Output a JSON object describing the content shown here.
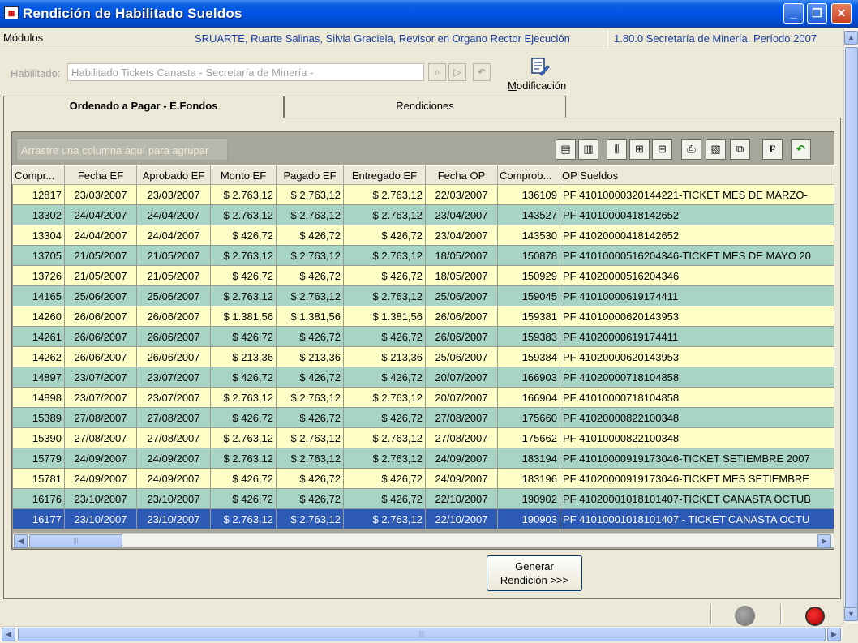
{
  "window": {
    "title": "Rendición de Habilitado Sueldos",
    "icon_name": "app-icon",
    "minimize_icon": "minimize-icon",
    "restore_icon": "restore-icon",
    "close_icon": "close-icon"
  },
  "menubar": {
    "modulos": "Módulos",
    "user_info": "SRUARTE, Ruarte Salinas, Silvia Graciela, Revisor en Organo Rector Ejecución",
    "version_info": "1.80.0 Secretaría de Minería, Período 2007"
  },
  "habilitado": {
    "label": "Habilitado:",
    "value": "Habilitado  Tickets Canasta - Secretaría de Minería -"
  },
  "toolbar": {
    "modificacion_label": "Modificación"
  },
  "tabs": [
    {
      "label": "Ordenado a Pagar - E.Fondos",
      "active": true
    },
    {
      "label": "Rendiciones",
      "active": false
    }
  ],
  "grid": {
    "group_by_placeholder": "Arrastre una columna aquí para agrupar",
    "columns": [
      "Compr...",
      "Fecha EF",
      "Aprobado EF",
      "Monto EF",
      "Pagado EF",
      "Entregado EF",
      "Fecha OP",
      "Comprob...",
      "OP Sueldos"
    ],
    "rows": [
      {
        "comp": "12817",
        "fecha_ef": "23/03/2007",
        "aprobado_ef": "23/03/2007",
        "monto": "$ 2.763,12",
        "pagado": "$ 2.763,12",
        "entregado": "$ 2.763,12",
        "fecha_op": "22/03/2007",
        "comprob": "136109",
        "op": "PF 41010000320144221-TICKET MES DE MARZO-",
        "color": "yellow"
      },
      {
        "comp": "13302",
        "fecha_ef": "24/04/2007",
        "aprobado_ef": "24/04/2007",
        "monto": "$ 2.763,12",
        "pagado": "$ 2.763,12",
        "entregado": "$ 2.763,12",
        "fecha_op": "23/04/2007",
        "comprob": "143527",
        "op": "PF 41010000418142652",
        "color": "green"
      },
      {
        "comp": "13304",
        "fecha_ef": "24/04/2007",
        "aprobado_ef": "24/04/2007",
        "monto": "$ 426,72",
        "pagado": "$ 426,72",
        "entregado": "$ 426,72",
        "fecha_op": "23/04/2007",
        "comprob": "143530",
        "op": "PF 41020000418142652",
        "color": "yellow"
      },
      {
        "comp": "13705",
        "fecha_ef": "21/05/2007",
        "aprobado_ef": "21/05/2007",
        "monto": "$ 2.763,12",
        "pagado": "$ 2.763,12",
        "entregado": "$ 2.763,12",
        "fecha_op": "18/05/2007",
        "comprob": "150878",
        "op": "PF 41010000516204346-TICKET MES DE MAYO 20",
        "color": "green"
      },
      {
        "comp": "13726",
        "fecha_ef": "21/05/2007",
        "aprobado_ef": "21/05/2007",
        "monto": "$ 426,72",
        "pagado": "$ 426,72",
        "entregado": "$ 426,72",
        "fecha_op": "18/05/2007",
        "comprob": "150929",
        "op": "PF 41020000516204346",
        "color": "yellow"
      },
      {
        "comp": "14165",
        "fecha_ef": "25/06/2007",
        "aprobado_ef": "25/06/2007",
        "monto": "$ 2.763,12",
        "pagado": "$ 2.763,12",
        "entregado": "$ 2.763,12",
        "fecha_op": "25/06/2007",
        "comprob": "159045",
        "op": "PF 41010000619174411",
        "color": "green"
      },
      {
        "comp": "14260",
        "fecha_ef": "26/06/2007",
        "aprobado_ef": "26/06/2007",
        "monto": "$ 1.381,56",
        "pagado": "$ 1.381,56",
        "entregado": "$ 1.381,56",
        "fecha_op": "26/06/2007",
        "comprob": "159381",
        "op": "PF 41010000620143953",
        "color": "yellow"
      },
      {
        "comp": "14261",
        "fecha_ef": "26/06/2007",
        "aprobado_ef": "26/06/2007",
        "monto": "$ 426,72",
        "pagado": "$ 426,72",
        "entregado": "$ 426,72",
        "fecha_op": "26/06/2007",
        "comprob": "159383",
        "op": "PF 41020000619174411",
        "color": "green"
      },
      {
        "comp": "14262",
        "fecha_ef": "26/06/2007",
        "aprobado_ef": "26/06/2007",
        "monto": "$ 213,36",
        "pagado": "$ 213,36",
        "entregado": "$ 213,36",
        "fecha_op": "25/06/2007",
        "comprob": "159384",
        "op": "PF 41020000620143953",
        "color": "yellow"
      },
      {
        "comp": "14897",
        "fecha_ef": "23/07/2007",
        "aprobado_ef": "23/07/2007",
        "monto": "$ 426,72",
        "pagado": "$ 426,72",
        "entregado": "$ 426,72",
        "fecha_op": "20/07/2007",
        "comprob": "166903",
        "op": "PF 41020000718104858",
        "color": "green"
      },
      {
        "comp": "14898",
        "fecha_ef": "23/07/2007",
        "aprobado_ef": "23/07/2007",
        "monto": "$ 2.763,12",
        "pagado": "$ 2.763,12",
        "entregado": "$ 2.763,12",
        "fecha_op": "20/07/2007",
        "comprob": "166904",
        "op": "PF 41010000718104858",
        "color": "yellow"
      },
      {
        "comp": "15389",
        "fecha_ef": "27/08/2007",
        "aprobado_ef": "27/08/2007",
        "monto": "$ 426,72",
        "pagado": "$ 426,72",
        "entregado": "$ 426,72",
        "fecha_op": "27/08/2007",
        "comprob": "175660",
        "op": "PF 41020000822100348",
        "color": "green"
      },
      {
        "comp": "15390",
        "fecha_ef": "27/08/2007",
        "aprobado_ef": "27/08/2007",
        "monto": "$ 2.763,12",
        "pagado": "$ 2.763,12",
        "entregado": "$ 2.763,12",
        "fecha_op": "27/08/2007",
        "comprob": "175662",
        "op": "PF 41010000822100348",
        "color": "yellow"
      },
      {
        "comp": "15779",
        "fecha_ef": "24/09/2007",
        "aprobado_ef": "24/09/2007",
        "monto": "$ 2.763,12",
        "pagado": "$ 2.763,12",
        "entregado": "$ 2.763,12",
        "fecha_op": "24/09/2007",
        "comprob": "183194",
        "op": "PF 41010000919173046-TICKET SETIEMBRE 2007",
        "color": "green"
      },
      {
        "comp": "15781",
        "fecha_ef": "24/09/2007",
        "aprobado_ef": "24/09/2007",
        "monto": "$ 426,72",
        "pagado": "$ 426,72",
        "entregado": "$ 426,72",
        "fecha_op": "24/09/2007",
        "comprob": "183196",
        "op": "PF 41020000919173046-TICKET MES SETIEMBRE",
        "color": "yellow"
      },
      {
        "comp": "16176",
        "fecha_ef": "23/10/2007",
        "aprobado_ef": "23/10/2007",
        "monto": "$ 426,72",
        "pagado": "$ 426,72",
        "entregado": "$ 426,72",
        "fecha_op": "22/10/2007",
        "comprob": "190902",
        "op": "PF 41020001018101407-TICKET CANASTA OCTUB",
        "color": "green"
      },
      {
        "comp": "16177",
        "fecha_ef": "23/10/2007",
        "aprobado_ef": "23/10/2007",
        "monto": "$ 2.763,12",
        "pagado": "$ 2.763,12",
        "entregado": "$ 2.763,12",
        "fecha_op": "22/10/2007",
        "comprob": "190903",
        "op": "PF 41010001018101407 - TICKET CANASTA OCTU",
        "color": "selected"
      }
    ]
  },
  "generar_button": {
    "line1": "Generar",
    "line2": "Rendición >>>"
  },
  "colors": {
    "row_yellow": "#ffffc8",
    "row_green": "#a8d4c5",
    "row_selected": "#2d5ab5",
    "info_text": "#1a3ea5"
  }
}
